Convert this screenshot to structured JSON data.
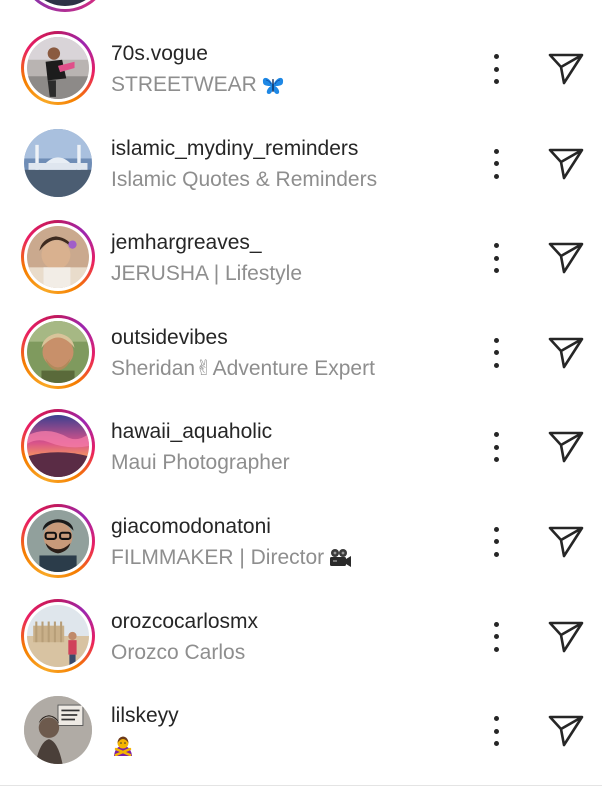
{
  "partial_row": {
    "text": ""
  },
  "suggestions": [
    {
      "username": "70s.vogue",
      "fullname": "STREETWEAR",
      "emoji": "butterfly-emoji",
      "story": true
    },
    {
      "username": "islamic_mydiny_reminders",
      "fullname": "Islamic Quotes & Reminders",
      "emoji": "",
      "story": false
    },
    {
      "username": "jemhargreaves_",
      "fullname": "JERUSHA | Lifestyle",
      "emoji": "",
      "story": true
    },
    {
      "username": "outsidevibes",
      "fullname": "Sheridan✌Adventure Expert",
      "emoji": "",
      "story": true
    },
    {
      "username": "hawaii_aquaholic",
      "fullname": "Maui Photographer",
      "emoji": "",
      "story": true
    },
    {
      "username": "giacomodonatoni",
      "fullname": "FILMMAKER | Director",
      "emoji": "movie-camera-emoji",
      "story": true
    },
    {
      "username": "orozcocarlosmx",
      "fullname": "Orozco Carlos",
      "emoji": "",
      "story": true
    },
    {
      "username": "lilskeyy",
      "fullname": "",
      "emoji": "woman-gesturing-no-emoji",
      "story": false
    }
  ],
  "icons": {
    "more": "more-options-icon",
    "send": "send-icon"
  },
  "colors": {
    "username": "#262626",
    "fullname": "#8e8e8e",
    "story_ring_start": "#f9a825",
    "story_ring_end": "#c2185b"
  }
}
